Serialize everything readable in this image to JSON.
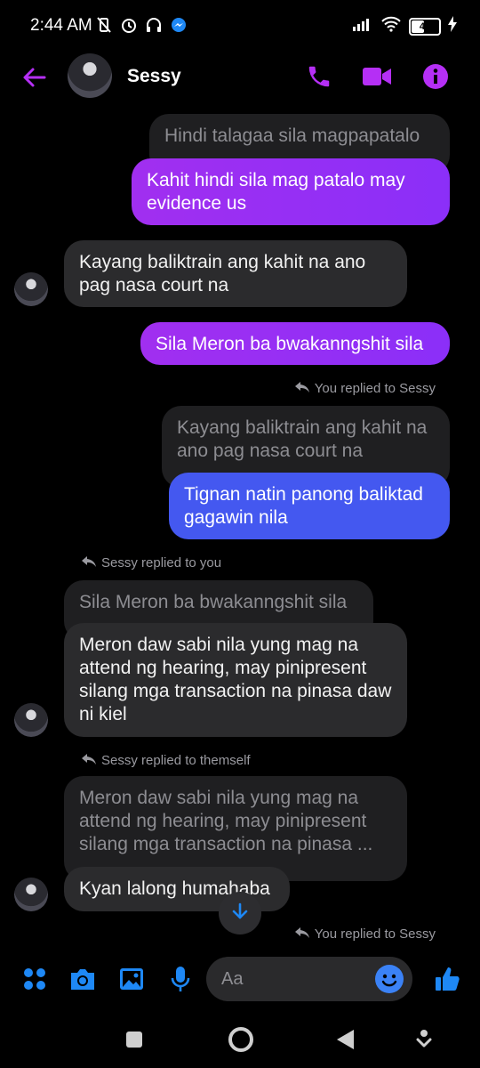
{
  "status_bar": {
    "time": "2:44 AM",
    "battery": "41"
  },
  "header": {
    "contact_name": "Sessy"
  },
  "messages": {
    "m1_quote": "Hindi talagaa sila magpapatalo",
    "m1_text": "Kahit hindi sila mag patalo may evidence us",
    "m2_text": "Kayang baliktrain ang kahit na ano pag nasa court na",
    "m3_text": "Sila Meron ba bwakanngshit sila",
    "m4_note": "You replied to Sessy",
    "m4_quote": "Kayang baliktrain ang kahit na ano pag nasa court na",
    "m4_text": "Tignan natin panong baliktad gagawin nila",
    "m5_note": "Sessy replied to you",
    "m5_quote": "Sila Meron ba bwakanngshit sila",
    "m5_text": "Meron daw sabi nila yung mag na attend ng hearing, may pinipresent silang mga transaction na pinasa daw ni kiel",
    "m6_note": "Sessy replied to themself",
    "m6_quote": "Meron daw sabi nila yung mag na attend ng hearing, may pinipresent silang mga transaction na pinasa ...",
    "m6_text": "Kyan lalong humahaba",
    "m7_note": "You replied to Sessy"
  },
  "composer": {
    "placeholder": "Aa"
  },
  "colors": {
    "accent_purple": "#a12ff0",
    "accent_blue": "#4458f0",
    "messenger_blue": "#1e88f5"
  }
}
